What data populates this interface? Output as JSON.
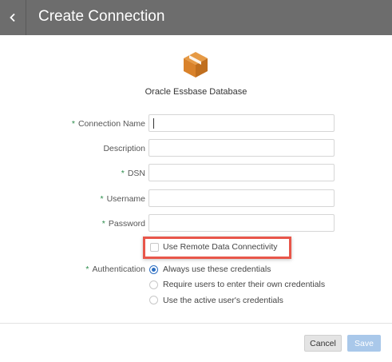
{
  "header": {
    "title": "Create Connection",
    "back_icon": "chevron-left-icon"
  },
  "database": {
    "icon": "cube-icon",
    "icon_color": "#d9822b",
    "name": "Oracle Essbase Database"
  },
  "form": {
    "required_marker": "*",
    "connection_name": {
      "label": "Connection Name",
      "required": true,
      "value": "",
      "focused": true
    },
    "description": {
      "label": "Description",
      "required": false,
      "value": ""
    },
    "dsn": {
      "label": "DSN",
      "required": true,
      "value": ""
    },
    "username": {
      "label": "Username",
      "required": true,
      "value": ""
    },
    "password": {
      "label": "Password",
      "required": true,
      "value": ""
    },
    "remote_data": {
      "label": "Use Remote Data Connectivity",
      "checked": false
    },
    "authentication": {
      "label": "Authentication",
      "required": true,
      "options": [
        {
          "label": "Always use these credentials",
          "selected": true
        },
        {
          "label": "Require users to enter their own credentials",
          "selected": false
        },
        {
          "label": "Use the active user's credentials",
          "selected": false
        }
      ]
    }
  },
  "footer": {
    "cancel_label": "Cancel",
    "save_label": "Save"
  },
  "colors": {
    "header_bg": "#6d6d6d",
    "required": "#2a8c4a",
    "highlight": "#e8564a",
    "radio_selected": "#2d6fc2",
    "save_disabled": "#a9c8ea"
  }
}
